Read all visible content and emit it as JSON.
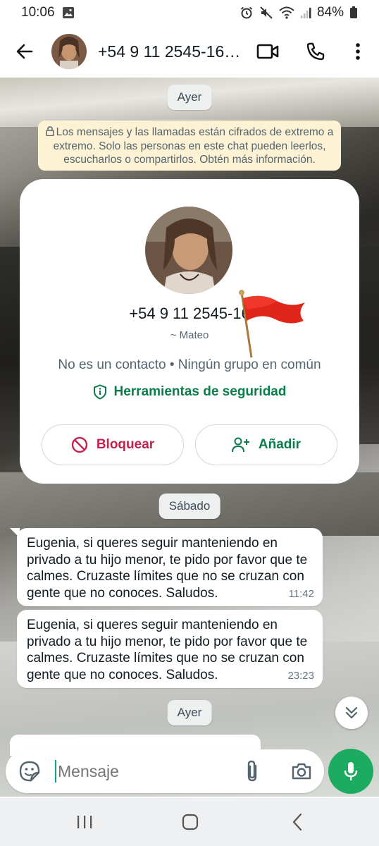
{
  "status_bar": {
    "time": "10:06",
    "battery": "84%"
  },
  "header": {
    "title": "+54 9 11 2545-16…"
  },
  "chat": {
    "date_top": "Ayer",
    "encryption_notice": "Los mensajes y las llamadas están cifrados de extremo a extremo. Solo las personas en este chat pueden leerlos, escucharlos o compartirlos. Obtén más información.",
    "profile": {
      "phone": "+54 9 11 2545-16",
      "name": "~ Mateo",
      "info": "No es un contacto • Ningún grupo en común",
      "safety_tools": "Herramientas de seguridad",
      "block_label": "Bloquear",
      "add_label": "Añadir"
    },
    "date_mid": "Sábado",
    "messages": [
      {
        "text": "Eugenia, si queres seguir manteniendo en privado a tu hijo menor, te pido por favor que te calmes. Cruzaste límites que no se cruzan con gente que no conoces. Saludos.",
        "time": "11:42"
      },
      {
        "text": "Eugenia, si queres seguir manteniendo en privado a tu hijo menor, te pido por favor que te calmes. Cruzaste límites que no se cruzan con gente que no conoces. Saludos.",
        "time": "23:23"
      }
    ],
    "date_bottom": "Ayer"
  },
  "input": {
    "placeholder": "Mensaje"
  },
  "icons": {
    "back": "arrow-left-icon",
    "video": "video-call-icon",
    "phone": "phone-icon",
    "menu": "more-vert-icon",
    "emoji": "sticker-icon",
    "attach": "paperclip-icon",
    "camera": "camera-icon",
    "mic": "mic-icon",
    "block": "block-icon",
    "add": "add-person-icon",
    "safety": "shield-icon",
    "flag": "red-flag-icon"
  },
  "colors": {
    "accent_green": "#1daa61",
    "safety_green": "#0a7d4b",
    "block_red": "#c4234e",
    "encryption_bg": "#fdf2d4",
    "flag_red": "#e0261b"
  }
}
